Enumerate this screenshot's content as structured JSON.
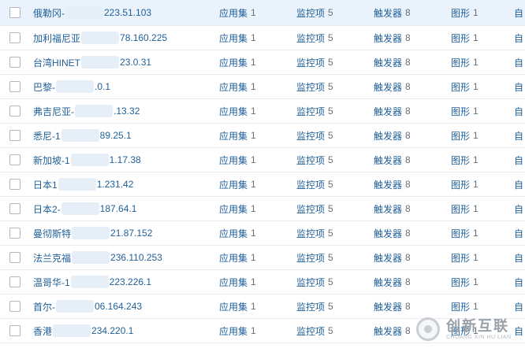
{
  "rows": [
    {
      "name_a": "俄勒冈-",
      "name_b": "223.51.103",
      "apps": "应用集",
      "apps_n": "1",
      "items": "监控项",
      "items_n": "5",
      "triggers": "触发器",
      "triggers_n": "8",
      "graphs": "图形",
      "graphs_n": "1",
      "disc": "自"
    },
    {
      "name_a": "加利福尼亚",
      "name_b": "78.160.225",
      "apps": "应用集",
      "apps_n": "1",
      "items": "监控项",
      "items_n": "5",
      "triggers": "触发器",
      "triggers_n": "8",
      "graphs": "图形",
      "graphs_n": "1",
      "disc": "自"
    },
    {
      "name_a": "台湾HINET",
      "name_b": "23.0.31",
      "apps": "应用集",
      "apps_n": "1",
      "items": "监控项",
      "items_n": "5",
      "triggers": "触发器",
      "triggers_n": "8",
      "graphs": "图形",
      "graphs_n": "1",
      "disc": "自"
    },
    {
      "name_a": "巴黎-",
      "name_b": ".0.1",
      "apps": "应用集",
      "apps_n": "1",
      "items": "监控项",
      "items_n": "5",
      "triggers": "触发器",
      "triggers_n": "8",
      "graphs": "图形",
      "graphs_n": "1",
      "disc": "自"
    },
    {
      "name_a": "弗吉尼亚-",
      "name_b": ".13.32",
      "apps": "应用集",
      "apps_n": "1",
      "items": "监控项",
      "items_n": "5",
      "triggers": "触发器",
      "triggers_n": "8",
      "graphs": "图形",
      "graphs_n": "1",
      "disc": "自"
    },
    {
      "name_a": "悉尼-1",
      "name_b": "89.25.1",
      "apps": "应用集",
      "apps_n": "1",
      "items": "监控项",
      "items_n": "5",
      "triggers": "触发器",
      "triggers_n": "8",
      "graphs": "图形",
      "graphs_n": "1",
      "disc": "自"
    },
    {
      "name_a": "新加坡-1",
      "name_b": "1.17.38",
      "apps": "应用集",
      "apps_n": "1",
      "items": "监控项",
      "items_n": "5",
      "triggers": "触发器",
      "triggers_n": "8",
      "graphs": "图形",
      "graphs_n": "1",
      "disc": "自"
    },
    {
      "name_a": "日本1",
      "name_b": "1.231.42",
      "apps": "应用集",
      "apps_n": "1",
      "items": "监控项",
      "items_n": "5",
      "triggers": "触发器",
      "triggers_n": "8",
      "graphs": "图形",
      "graphs_n": "1",
      "disc": "自"
    },
    {
      "name_a": "日本2-",
      "name_b": "187.64.1",
      "apps": "应用集",
      "apps_n": "1",
      "items": "监控项",
      "items_n": "5",
      "triggers": "触发器",
      "triggers_n": "8",
      "graphs": "图形",
      "graphs_n": "1",
      "disc": "自"
    },
    {
      "name_a": "曼彻斯特",
      "name_b": "21.87.152",
      "apps": "应用集",
      "apps_n": "1",
      "items": "监控项",
      "items_n": "5",
      "triggers": "触发器",
      "triggers_n": "8",
      "graphs": "图形",
      "graphs_n": "1",
      "disc": "自"
    },
    {
      "name_a": "法兰克福",
      "name_b": "236.110.253",
      "apps": "应用集",
      "apps_n": "1",
      "items": "监控项",
      "items_n": "5",
      "triggers": "触发器",
      "triggers_n": "8",
      "graphs": "图形",
      "graphs_n": "1",
      "disc": "自"
    },
    {
      "name_a": "温哥华-1",
      "name_b": "223.226.1",
      "apps": "应用集",
      "apps_n": "1",
      "items": "监控项",
      "items_n": "5",
      "triggers": "触发器",
      "triggers_n": "8",
      "graphs": "图形",
      "graphs_n": "1",
      "disc": "自"
    },
    {
      "name_a": "首尔-",
      "name_b": "06.164.243",
      "apps": "应用集",
      "apps_n": "1",
      "items": "监控项",
      "items_n": "5",
      "triggers": "触发器",
      "triggers_n": "8",
      "graphs": "图形",
      "graphs_n": "1",
      "disc": "自"
    },
    {
      "name_a": "香港",
      "name_b": "234.220.1",
      "apps": "应用集",
      "apps_n": "1",
      "items": "监控项",
      "items_n": "5",
      "triggers": "触发器",
      "triggers_n": "8",
      "graphs": "图形",
      "graphs_n": "1",
      "disc": "自"
    }
  ],
  "watermark": {
    "cn": "创新互联",
    "en": "CHUANG XIN HU LIAN"
  },
  "colors": {
    "link": "#1f5f99",
    "count": "#666f78",
    "row_highlight": "#eaf3fb",
    "border": "#e8ecef"
  }
}
